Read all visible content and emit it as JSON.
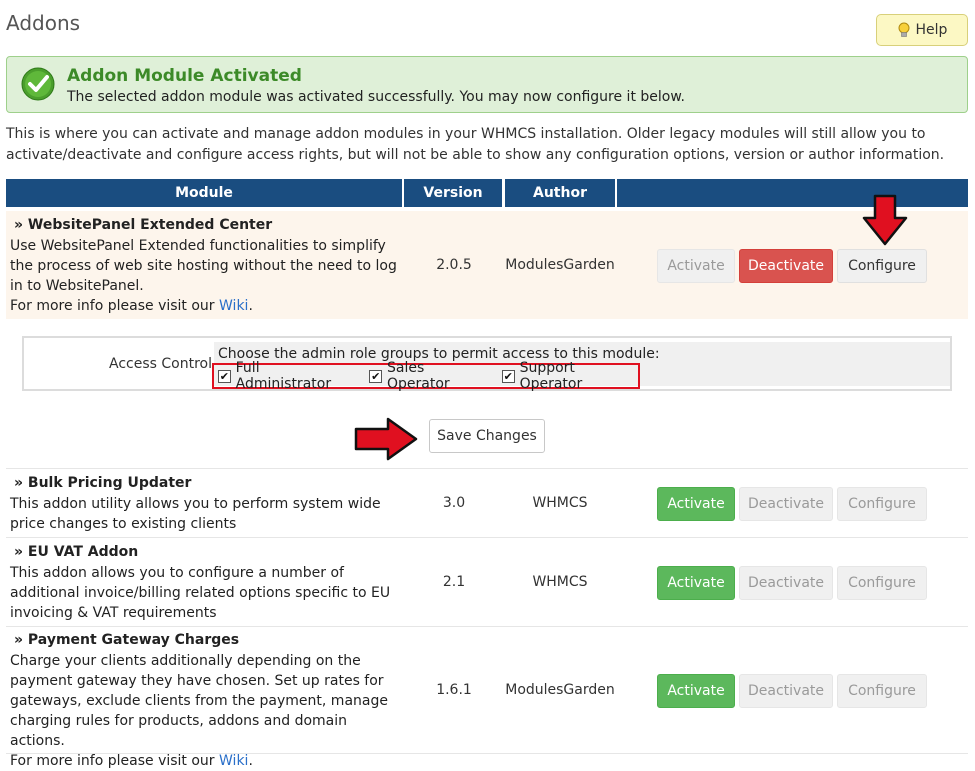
{
  "page": {
    "title": "Addons",
    "help_label": "Help"
  },
  "alert": {
    "title": "Addon Module Activated",
    "message": "The selected addon module was activated successfully. You may now configure it below."
  },
  "intro_text": "This is where you can activate and manage addon modules in your WHMCS installation. Older legacy modules will still allow you to activate/deactivate and configure access rights, but will not be able to show any configuration options, version or author information.",
  "table": {
    "headers": [
      "Module",
      "Version",
      "Author",
      ""
    ]
  },
  "modules": [
    {
      "name": "» WebsitePanel Extended Center",
      "description": "Use WebsitePanel Extended functionalities to simplify the process of web site hosting without the need to log in to WebsitePanel.",
      "more_info_prefix": "For more info please visit our ",
      "wiki_label": "Wiki",
      "more_info_suffix": ".",
      "version": "2.0.5",
      "author": "ModulesGarden",
      "buttons": {
        "activate": "Activate",
        "deactivate": "Deactivate",
        "configure": "Configure"
      }
    },
    {
      "name": "» Bulk Pricing Updater",
      "description": "This addon utility allows you to perform system wide price changes to existing clients",
      "version": "3.0",
      "author": "WHMCS",
      "buttons": {
        "activate": "Activate",
        "deactivate": "Deactivate",
        "configure": "Configure"
      }
    },
    {
      "name": "» EU VAT Addon",
      "description": "This addon allows you to configure a number of additional invoice/billing related options specific to EU invoicing & VAT requirements",
      "version": "2.1",
      "author": "WHMCS",
      "buttons": {
        "activate": "Activate",
        "deactivate": "Deactivate",
        "configure": "Configure"
      }
    },
    {
      "name": "» Payment Gateway Charges",
      "description": "Charge your clients additionally depending on the payment gateway they have chosen. Set up rates for gateways, exclude clients from the payment, manage charging rules for products, addons and domain actions.",
      "more_info_prefix": "For more info please visit our ",
      "wiki_label": "Wiki",
      "more_info_suffix": ".",
      "version": "1.6.1",
      "author": "ModulesGarden",
      "buttons": {
        "activate": "Activate",
        "deactivate": "Deactivate",
        "configure": "Configure"
      }
    }
  ],
  "access_control": {
    "label": "Access Control",
    "prompt": "Choose the admin role groups to permit access to this module:",
    "roles": [
      {
        "label": "Full Administrator",
        "checked": true
      },
      {
        "label": "Sales Operator",
        "checked": true
      },
      {
        "label": "Support Operator",
        "checked": true
      }
    ],
    "save_label": "Save Changes"
  },
  "colors": {
    "header_bg": "#1a4d80",
    "success_bg": "#dff0d8",
    "activate_green": "#5cb85c",
    "deactivate_red": "#d9534f",
    "annotation_red": "#e01020"
  },
  "icons": {
    "help": "lightbulb-icon",
    "alert": "checkmark-circle-icon",
    "annotation": "red-arrow-icon"
  }
}
